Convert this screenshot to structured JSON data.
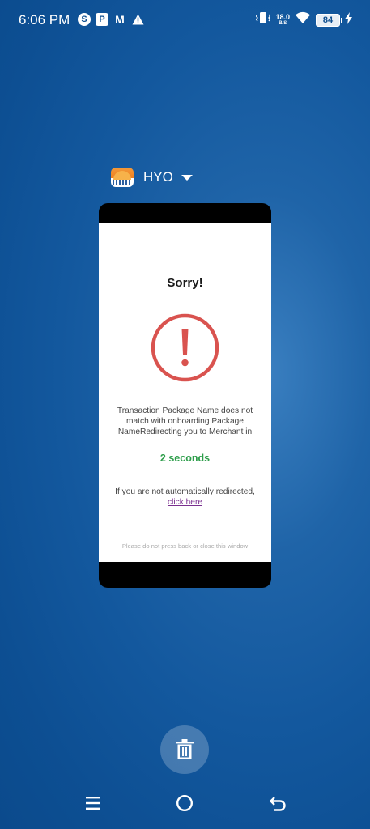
{
  "status_bar": {
    "time": "6:06 PM",
    "left_icons": [
      "skype-icon",
      "app-icon",
      "gmail-icon",
      "warning-icon"
    ],
    "net_speed_value": "18.0",
    "net_speed_unit": "B/S",
    "battery": "84"
  },
  "app": {
    "name": "HYO"
  },
  "dialog": {
    "title": "Sorry!",
    "message": "Transaction Package Name does not match with onboarding Package NameRedirecting you to Merchant in",
    "countdown": "2 seconds",
    "redirect_prefix": "If you are not automatically redirected, ",
    "redirect_link": "click here",
    "footer": "Please do not press back or close this window",
    "colors": {
      "alert": "#d9534f",
      "countdown": "#2e9e4b",
      "link": "#7a2f8f"
    }
  },
  "actions": {
    "clear_icon": "trash-icon"
  },
  "nav_bar": {
    "buttons": [
      "menu-icon",
      "home-icon",
      "back-icon"
    ]
  }
}
